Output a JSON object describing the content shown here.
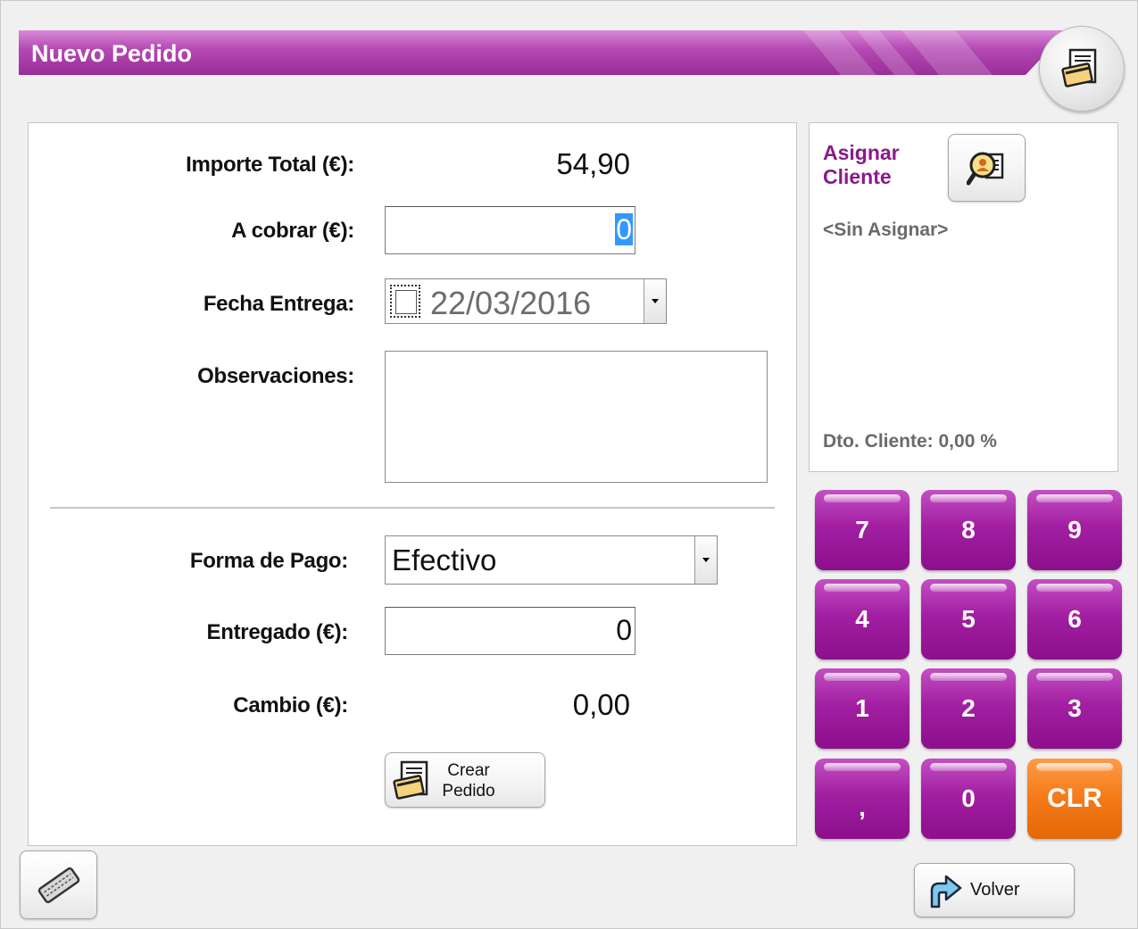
{
  "window": {
    "title": "Nuevo Pedido"
  },
  "form": {
    "importe_total_label": "Importe Total (€):",
    "importe_total_value": "54,90",
    "a_cobrar_label": "A cobrar (€):",
    "a_cobrar_value": "0",
    "fecha_entrega_label": "Fecha Entrega:",
    "fecha_entrega_value": "22/03/2016",
    "observaciones_label": "Observaciones:",
    "observaciones_value": "",
    "forma_pago_label": "Forma de Pago:",
    "forma_pago_value": "Efectivo",
    "entregado_label": "Entregado (€):",
    "entregado_value": "0",
    "cambio_label": "Cambio (€):",
    "cambio_value": "0,00",
    "crear_pedido_line1": "Crear",
    "crear_pedido_line2": "Pedido"
  },
  "client": {
    "assign_line1": "Asignar",
    "assign_line2": "Cliente",
    "name": "<Sin Asignar>",
    "discount": "Dto. Cliente: 0,00 %"
  },
  "keypad": {
    "k7": "7",
    "k8": "8",
    "k9": "9",
    "k4": "4",
    "k5": "5",
    "k6": "6",
    "k1": "1",
    "k2": "2",
    "k3": "3",
    "kcomma": ",",
    "k0": "0",
    "kclr": "CLR"
  },
  "footer": {
    "volver_label": "Volver"
  },
  "colors": {
    "accent": "#a21fa2",
    "orange": "#f47a18",
    "client_title": "#8b1a8b"
  }
}
